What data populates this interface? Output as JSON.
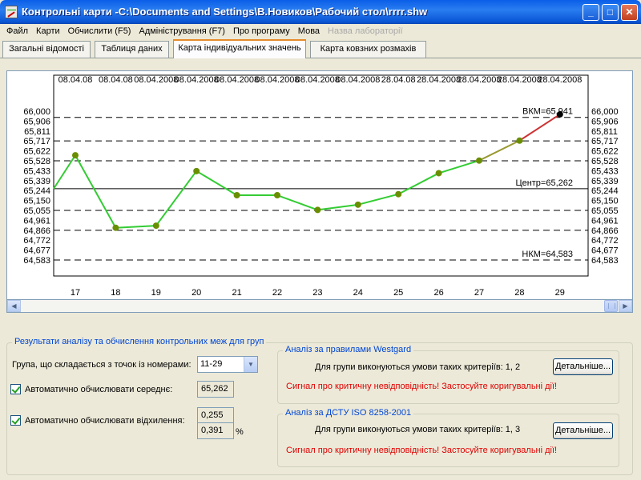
{
  "window": {
    "title": "Контрольні карти -C:\\Documents and Settings\\В.Новиков\\Рабочий стол\\rrrr.shw",
    "minimize": "_",
    "maximize": "□",
    "close": "✕"
  },
  "menu": [
    {
      "label": "Файл",
      "enabled": true
    },
    {
      "label": "Карти",
      "enabled": true
    },
    {
      "label": "Обчислити (F5)",
      "enabled": true
    },
    {
      "label": "Адміністрування (F7)",
      "enabled": true
    },
    {
      "label": "Про програму",
      "enabled": true
    },
    {
      "label": "Мова",
      "enabled": true
    },
    {
      "label": "Назва лабораторії",
      "enabled": false
    }
  ],
  "tabs": [
    {
      "label": "Загальні відомості",
      "active": false
    },
    {
      "label": "Таблиця даних",
      "active": false
    },
    {
      "label": "Карта індивідуальних значень",
      "active": true
    },
    {
      "label": "Карта ковзних розмахів",
      "active": false
    }
  ],
  "chart_data": {
    "type": "line",
    "top_labels": [
      "08.04.08",
      "08.04.08",
      "08.04.2008",
      "08.04.2008",
      "08.04.2008",
      "08.04.2008",
      "08.04.2008",
      "08.04.2008",
      "28.04.08",
      "28.04.2008",
      "28.04.2008",
      "28.04.2008",
      "28.04.2008"
    ],
    "x": [
      17,
      18,
      19,
      20,
      21,
      22,
      23,
      24,
      25,
      26,
      27,
      28,
      29
    ],
    "y": [
      65.58,
      64.89,
      64.91,
      65.43,
      65.2,
      65.2,
      65.06,
      65.11,
      65.21,
      65.41,
      65.53,
      65.72,
      65.97
    ],
    "y_ticks": [
      "66,000",
      "65,906",
      "65,811",
      "65,717",
      "65,622",
      "65,528",
      "65,433",
      "65,339",
      "65,244",
      "65,150",
      "65,055",
      "64,961",
      "64,866",
      "64,772",
      "64,677",
      "64,583"
    ],
    "ylim": [
      64.583,
      66.0
    ],
    "ucl": {
      "value": 65.941,
      "label": "ВКМ=65,941"
    },
    "center": {
      "value": 65.262,
      "label": "Центр=65,262"
    },
    "lcl": {
      "value": 64.583,
      "label": "НКМ=64,583"
    },
    "dashed_levels": [
      65.941,
      65.717,
      65.528,
      65.055,
      64.866,
      64.583
    ],
    "colors": {
      "line": "#33cc33",
      "line_warn": "#cc3333",
      "marker": "#6b8e00",
      "marker_last": "#000000"
    }
  },
  "results": {
    "title": "Результати аналізу та обчислення контрольних меж для груп",
    "group_label": "Група, що складається з точок із номерами:",
    "group_value": "11-29",
    "auto_mean_label": "Автоматично обчислювати середнє:",
    "mean_value": "65,262",
    "auto_dev_label": "Автоматично обчислювати відхилення:",
    "dev_value": "0,255",
    "dev_percent": "0,391",
    "percent_sign": "%"
  },
  "westgard": {
    "title": "Аналіз за правилами Westgard",
    "criteria": "Для групи виконуються умови таких критеріїв: 1, 2",
    "details": "Детальніше...",
    "signal": "Сигнал про критичну невідповідність! Застосуйте коригувальні дії!"
  },
  "dstu": {
    "title": "Аналіз за ДСТУ ISO 8258-2001",
    "criteria": "Для групи виконуються умови таких критеріїв: 1, 3",
    "details": "Детальніше...",
    "signal": "Сигнал про критичну невідповідність! Застосуйте коригувальні дії!"
  }
}
